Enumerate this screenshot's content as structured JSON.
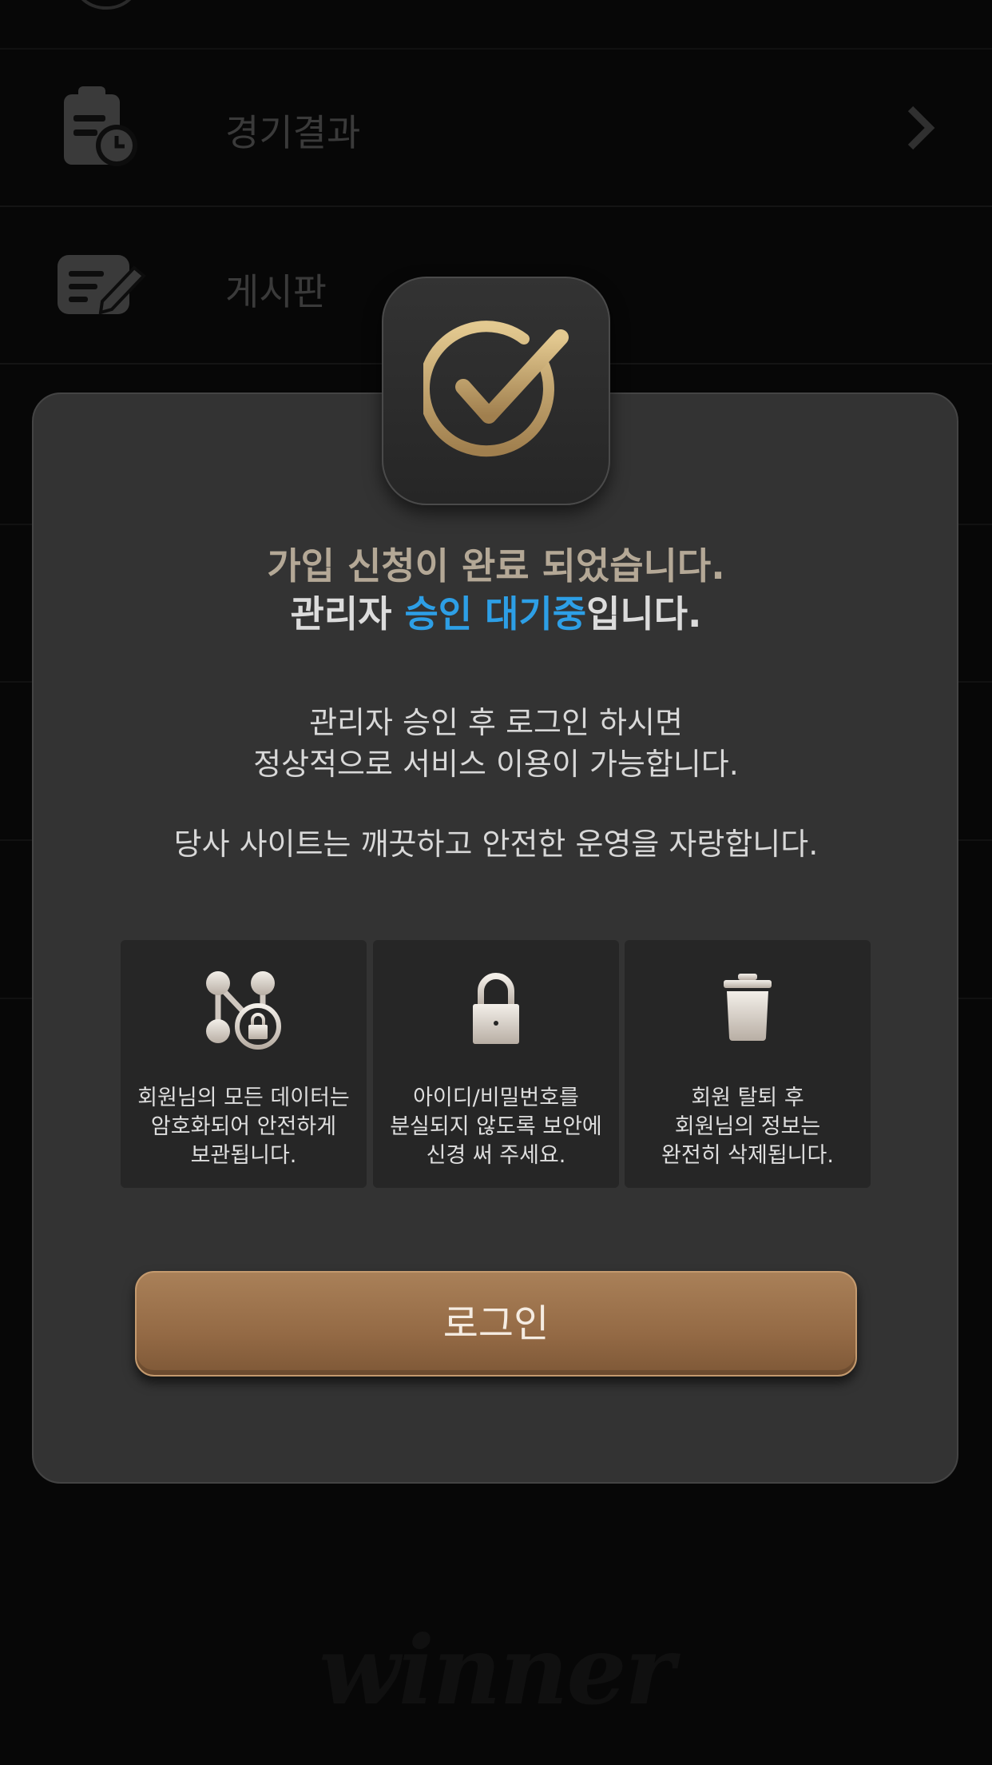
{
  "background_menu": {
    "items": [
      {
        "label": "경기결과",
        "icon": "clipboard-clock-icon"
      },
      {
        "label": "게시판",
        "icon": "edit-board-icon"
      }
    ],
    "watermark": "winner"
  },
  "modal": {
    "badge_icon": "check-circle-icon",
    "title_line1": "가입 신청이 완료 되었습니다.",
    "title_line2_prefix": "관리자 ",
    "title_line2_accent": "승인 대기중",
    "title_line2_suffix": "입니다.",
    "message_line1": "관리자 승인 후 로그인 하시면",
    "message_line2": "정상적으로 서비스 이용이 가능합니다.",
    "message_line3": "당사 사이트는 깨끗하고 안전한 운영을 자랑합니다.",
    "features": [
      {
        "icon": "encrypted-network-icon",
        "line1": "회원님의 모든 데이터는",
        "line2": "암호화되어 안전하게",
        "line3": "보관됩니다."
      },
      {
        "icon": "lock-icon",
        "line1": "아이디/비밀번호를",
        "line2": "분실되지 않도록 보안에",
        "line3": "신경 써 주세요."
      },
      {
        "icon": "trash-icon",
        "line1": "회원 탈퇴 후",
        "line2": "회원님의 정보는",
        "line3": "완전히 삭제됩니다."
      }
    ],
    "login_button_label": "로그인"
  },
  "colors": {
    "accent_blue": "#2d9fe6",
    "button_gold": "#a98058",
    "modal_bg": "#333333"
  }
}
